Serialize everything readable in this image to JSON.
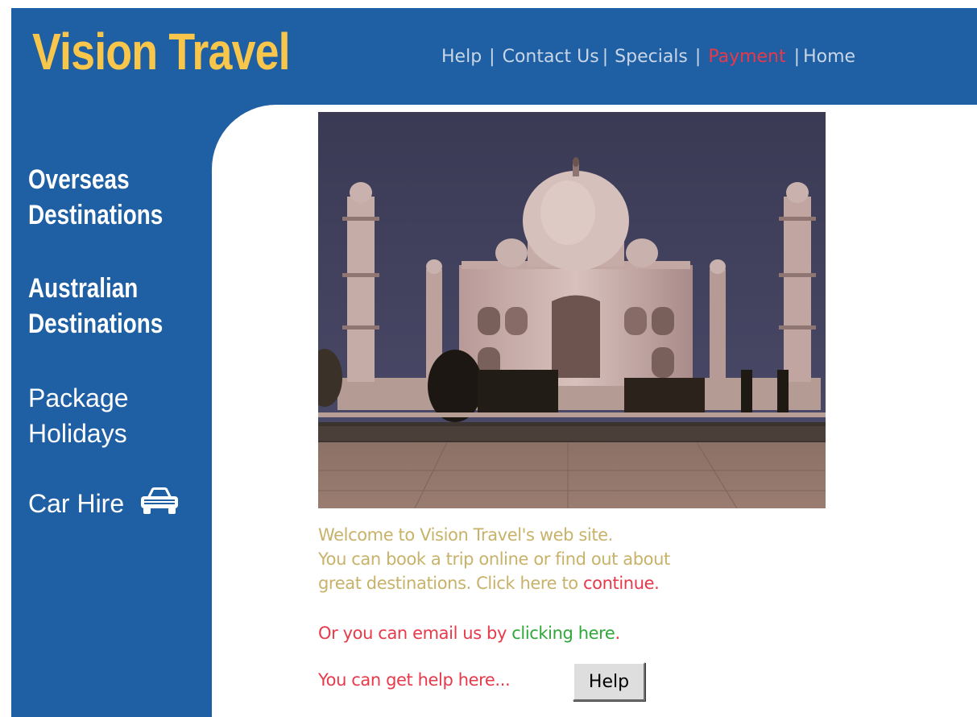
{
  "site": {
    "logo": "Vision Travel"
  },
  "top_nav": {
    "items": [
      "Help",
      "Contact Us",
      "Specials",
      "Payment",
      "Home"
    ],
    "separator": "|",
    "active_item": "Payment"
  },
  "sidebar": {
    "overseas": {
      "line1": "Overseas",
      "line2": "Destinations"
    },
    "australian": {
      "line1": "Australian",
      "line2": "Destinations"
    },
    "package": {
      "line1": "Package",
      "line2": "Holidays"
    },
    "car_hire": {
      "label": "Car Hire",
      "icon": "car-icon"
    }
  },
  "welcome": {
    "line1": "Welcome to Vision Travel's web site.",
    "line2": "You can book a trip online or find out about",
    "line3_prefix": "great destinations. Click here to ",
    "continue_link": "continue",
    "line3_suffix": "."
  },
  "email": {
    "prefix": "Or you can email us by ",
    "link": "clicking here",
    "suffix": "."
  },
  "help": {
    "prompt": "You can get help here...",
    "button_label": "Help"
  },
  "colors": {
    "brand_blue": "#1f5fa3",
    "logo_yellow": "#f8c64a",
    "link_red": "#e8394a",
    "link_green": "#2fa83a",
    "welcome_text": "#c8b26a"
  }
}
